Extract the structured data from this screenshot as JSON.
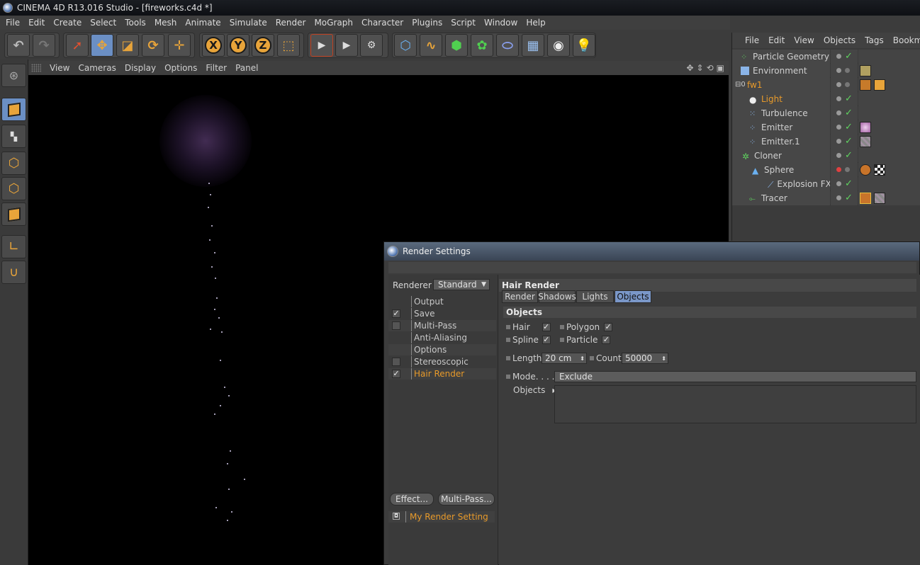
{
  "window": {
    "title": "CINEMA 4D R13.016 Studio - [fireworks.c4d *]"
  },
  "menubar": [
    "File",
    "Edit",
    "Create",
    "Select",
    "Tools",
    "Mesh",
    "Animate",
    "Simulate",
    "Render",
    "MoGraph",
    "Character",
    "Plugins",
    "Script",
    "Window",
    "Help"
  ],
  "toolbar": {
    "undo_icon": "undo-icon",
    "redo_icon": "redo-icon",
    "axis_labels": [
      "X",
      "Y",
      "Z"
    ]
  },
  "viewport": {
    "menu": [
      "View",
      "Cameras",
      "Display",
      "Options",
      "Filter",
      "Panel"
    ],
    "nav_icons": [
      "move-view-icon",
      "zoom-view-icon",
      "rotate-view-icon",
      "toggle-view-icon"
    ]
  },
  "object_manager": {
    "menu": [
      "File",
      "Edit",
      "View",
      "Objects",
      "Tags",
      "Bookmar"
    ],
    "objects": [
      {
        "name": "Particle Geometry",
        "icon": "particle-geometry-icon",
        "highlight": false
      },
      {
        "name": "Environment",
        "icon": "environment-icon",
        "highlight": false
      },
      {
        "name": "fw1",
        "icon": "null-icon",
        "highlight": true
      },
      {
        "name": "Light",
        "icon": "light-icon",
        "highlight": true
      },
      {
        "name": "Turbulence",
        "icon": "turbulence-icon",
        "highlight": false
      },
      {
        "name": "Emitter",
        "icon": "emitter-icon",
        "highlight": false
      },
      {
        "name": "Emitter.1",
        "icon": "emitter-icon",
        "highlight": false
      },
      {
        "name": "Cloner",
        "icon": "cloner-icon",
        "highlight": false
      },
      {
        "name": "Sphere",
        "icon": "sphere-icon",
        "highlight": false
      },
      {
        "name": "Explosion FX",
        "icon": "explosion-fx-icon",
        "highlight": false
      },
      {
        "name": "Tracer",
        "icon": "tracer-icon",
        "highlight": false
      }
    ]
  },
  "render_settings": {
    "title": "Render Settings",
    "renderer_label": "Renderer",
    "renderer_value": "Standard",
    "items": [
      {
        "label": "Output",
        "checkbox": false,
        "checked": false,
        "highlight": false
      },
      {
        "label": "Save",
        "checkbox": true,
        "checked": true,
        "highlight": false
      },
      {
        "label": "Multi-Pass",
        "checkbox": true,
        "checked": false,
        "highlight": false
      },
      {
        "label": "Anti-Aliasing",
        "checkbox": false,
        "checked": false,
        "highlight": false
      },
      {
        "label": "Options",
        "checkbox": false,
        "checked": false,
        "highlight": false
      },
      {
        "label": "Stereoscopic",
        "checkbox": true,
        "checked": false,
        "highlight": false
      },
      {
        "label": "Hair Render",
        "checkbox": true,
        "checked": true,
        "highlight": true
      }
    ],
    "effect_button": "Effect...",
    "multipass_button": "Multi-Pass...",
    "preset": "My Render Setting",
    "panel_title": "Hair Render",
    "tabs": [
      {
        "label": "Render",
        "selected": false
      },
      {
        "label": "Shadows",
        "selected": false
      },
      {
        "label": "Lights",
        "selected": false
      },
      {
        "label": "Objects",
        "selected": true
      }
    ],
    "section": "Objects",
    "options": {
      "hair": "Hair",
      "polygon": "Polygon",
      "spline": "Spline",
      "particle": "Particle",
      "length_label": "Length",
      "length_value": "20 cm",
      "count_label": "Count",
      "count_value": "50000",
      "mode_label": "Mode. . . .",
      "mode_value": "Exclude",
      "objects_label": "Objects"
    }
  }
}
